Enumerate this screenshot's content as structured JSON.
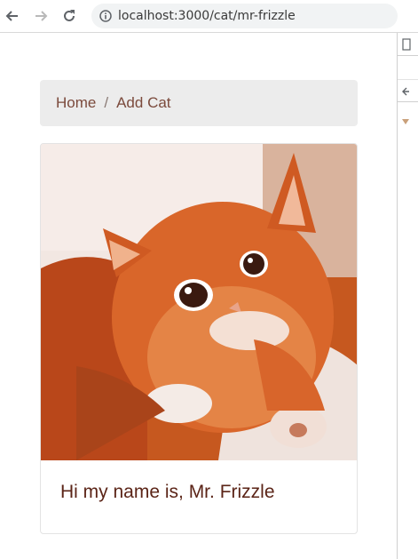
{
  "browser": {
    "url": "localhost:3000/cat/mr-frizzle",
    "icons": {
      "back": "arrow-left-icon",
      "forward": "arrow-right-icon",
      "reload": "reload-icon",
      "info": "info-circle-icon"
    }
  },
  "breadcrumb": {
    "items": [
      {
        "label": "Home"
      },
      {
        "label": "Add Cat"
      }
    ],
    "separator": "/"
  },
  "cat_card": {
    "image": "ginger-kitten-photo",
    "title": "Hi my name is, Mr. Frizzle"
  },
  "colors": {
    "breadcrumb_text": "#7b4a3c",
    "title_text": "#5b2417",
    "breadcrumb_bg": "#ececec",
    "accent_orange": "#d9662a"
  }
}
